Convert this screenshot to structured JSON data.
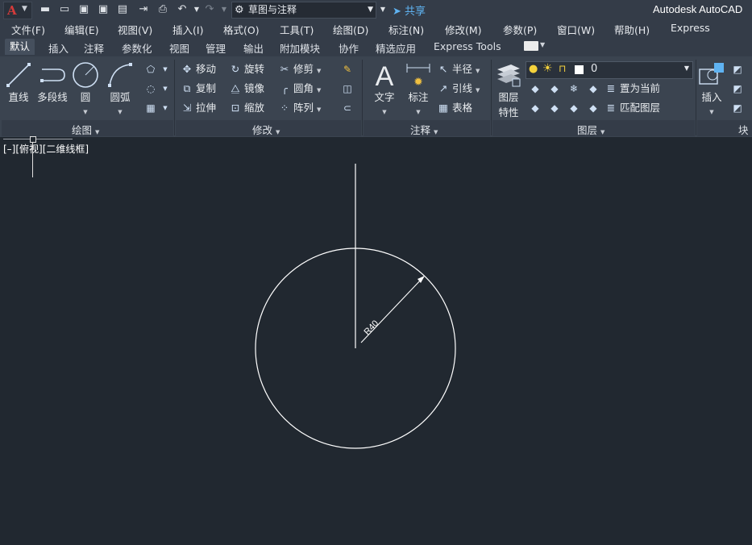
{
  "quick_access": {
    "workspace_value": "草图与注释",
    "share_label": "共享",
    "app_title": "Autodesk AutoCAD"
  },
  "menu_bar": [
    {
      "label": "文件(F)"
    },
    {
      "label": "编辑(E)"
    },
    {
      "label": "视图(V)"
    },
    {
      "label": "插入(I)"
    },
    {
      "label": "格式(O)"
    },
    {
      "label": "工具(T)"
    },
    {
      "label": "绘图(D)"
    },
    {
      "label": "标注(N)"
    },
    {
      "label": "修改(M)"
    },
    {
      "label": "参数(P)"
    },
    {
      "label": "窗口(W)"
    },
    {
      "label": "帮助(H)"
    },
    {
      "label": "Express"
    }
  ],
  "ribbon_tabs": [
    {
      "label": "默认"
    },
    {
      "label": "插入"
    },
    {
      "label": "注释"
    },
    {
      "label": "参数化"
    },
    {
      "label": "视图"
    },
    {
      "label": "管理"
    },
    {
      "label": "输出"
    },
    {
      "label": "附加模块"
    },
    {
      "label": "协作"
    },
    {
      "label": "精选应用"
    },
    {
      "label": "Express Tools"
    }
  ],
  "panels": {
    "draw": {
      "title": "绘图",
      "line": "直线",
      "polyline": "多段线",
      "circle": "圆",
      "arc": "圆弧"
    },
    "modify": {
      "title": "修改",
      "move": "移动",
      "rotate": "旋转",
      "trim": "修剪",
      "copy": "复制",
      "mirror": "镜像",
      "fillet": "圆角",
      "stretch": "拉伸",
      "scale": "缩放",
      "array": "阵列"
    },
    "annotation": {
      "title": "注释",
      "text": "文字",
      "dimension": "标注",
      "radius": "半径",
      "leader": "引线",
      "table": "表格"
    },
    "layers": {
      "title": "图层",
      "properties_line1": "图层",
      "properties_line2": "特性",
      "current_layer": "0",
      "make_current": "置为当前",
      "match_layer": "匹配图层"
    },
    "block": {
      "title": "块",
      "insert": "插入"
    }
  },
  "viewport": {
    "label": "[–][俯视][二维线框]",
    "dimension_text": "R40"
  },
  "colors": {
    "background": "#212830",
    "ribbon": "#3b4450",
    "accent_share": "#5fb3f2",
    "drawing_line": "#ffffff"
  }
}
